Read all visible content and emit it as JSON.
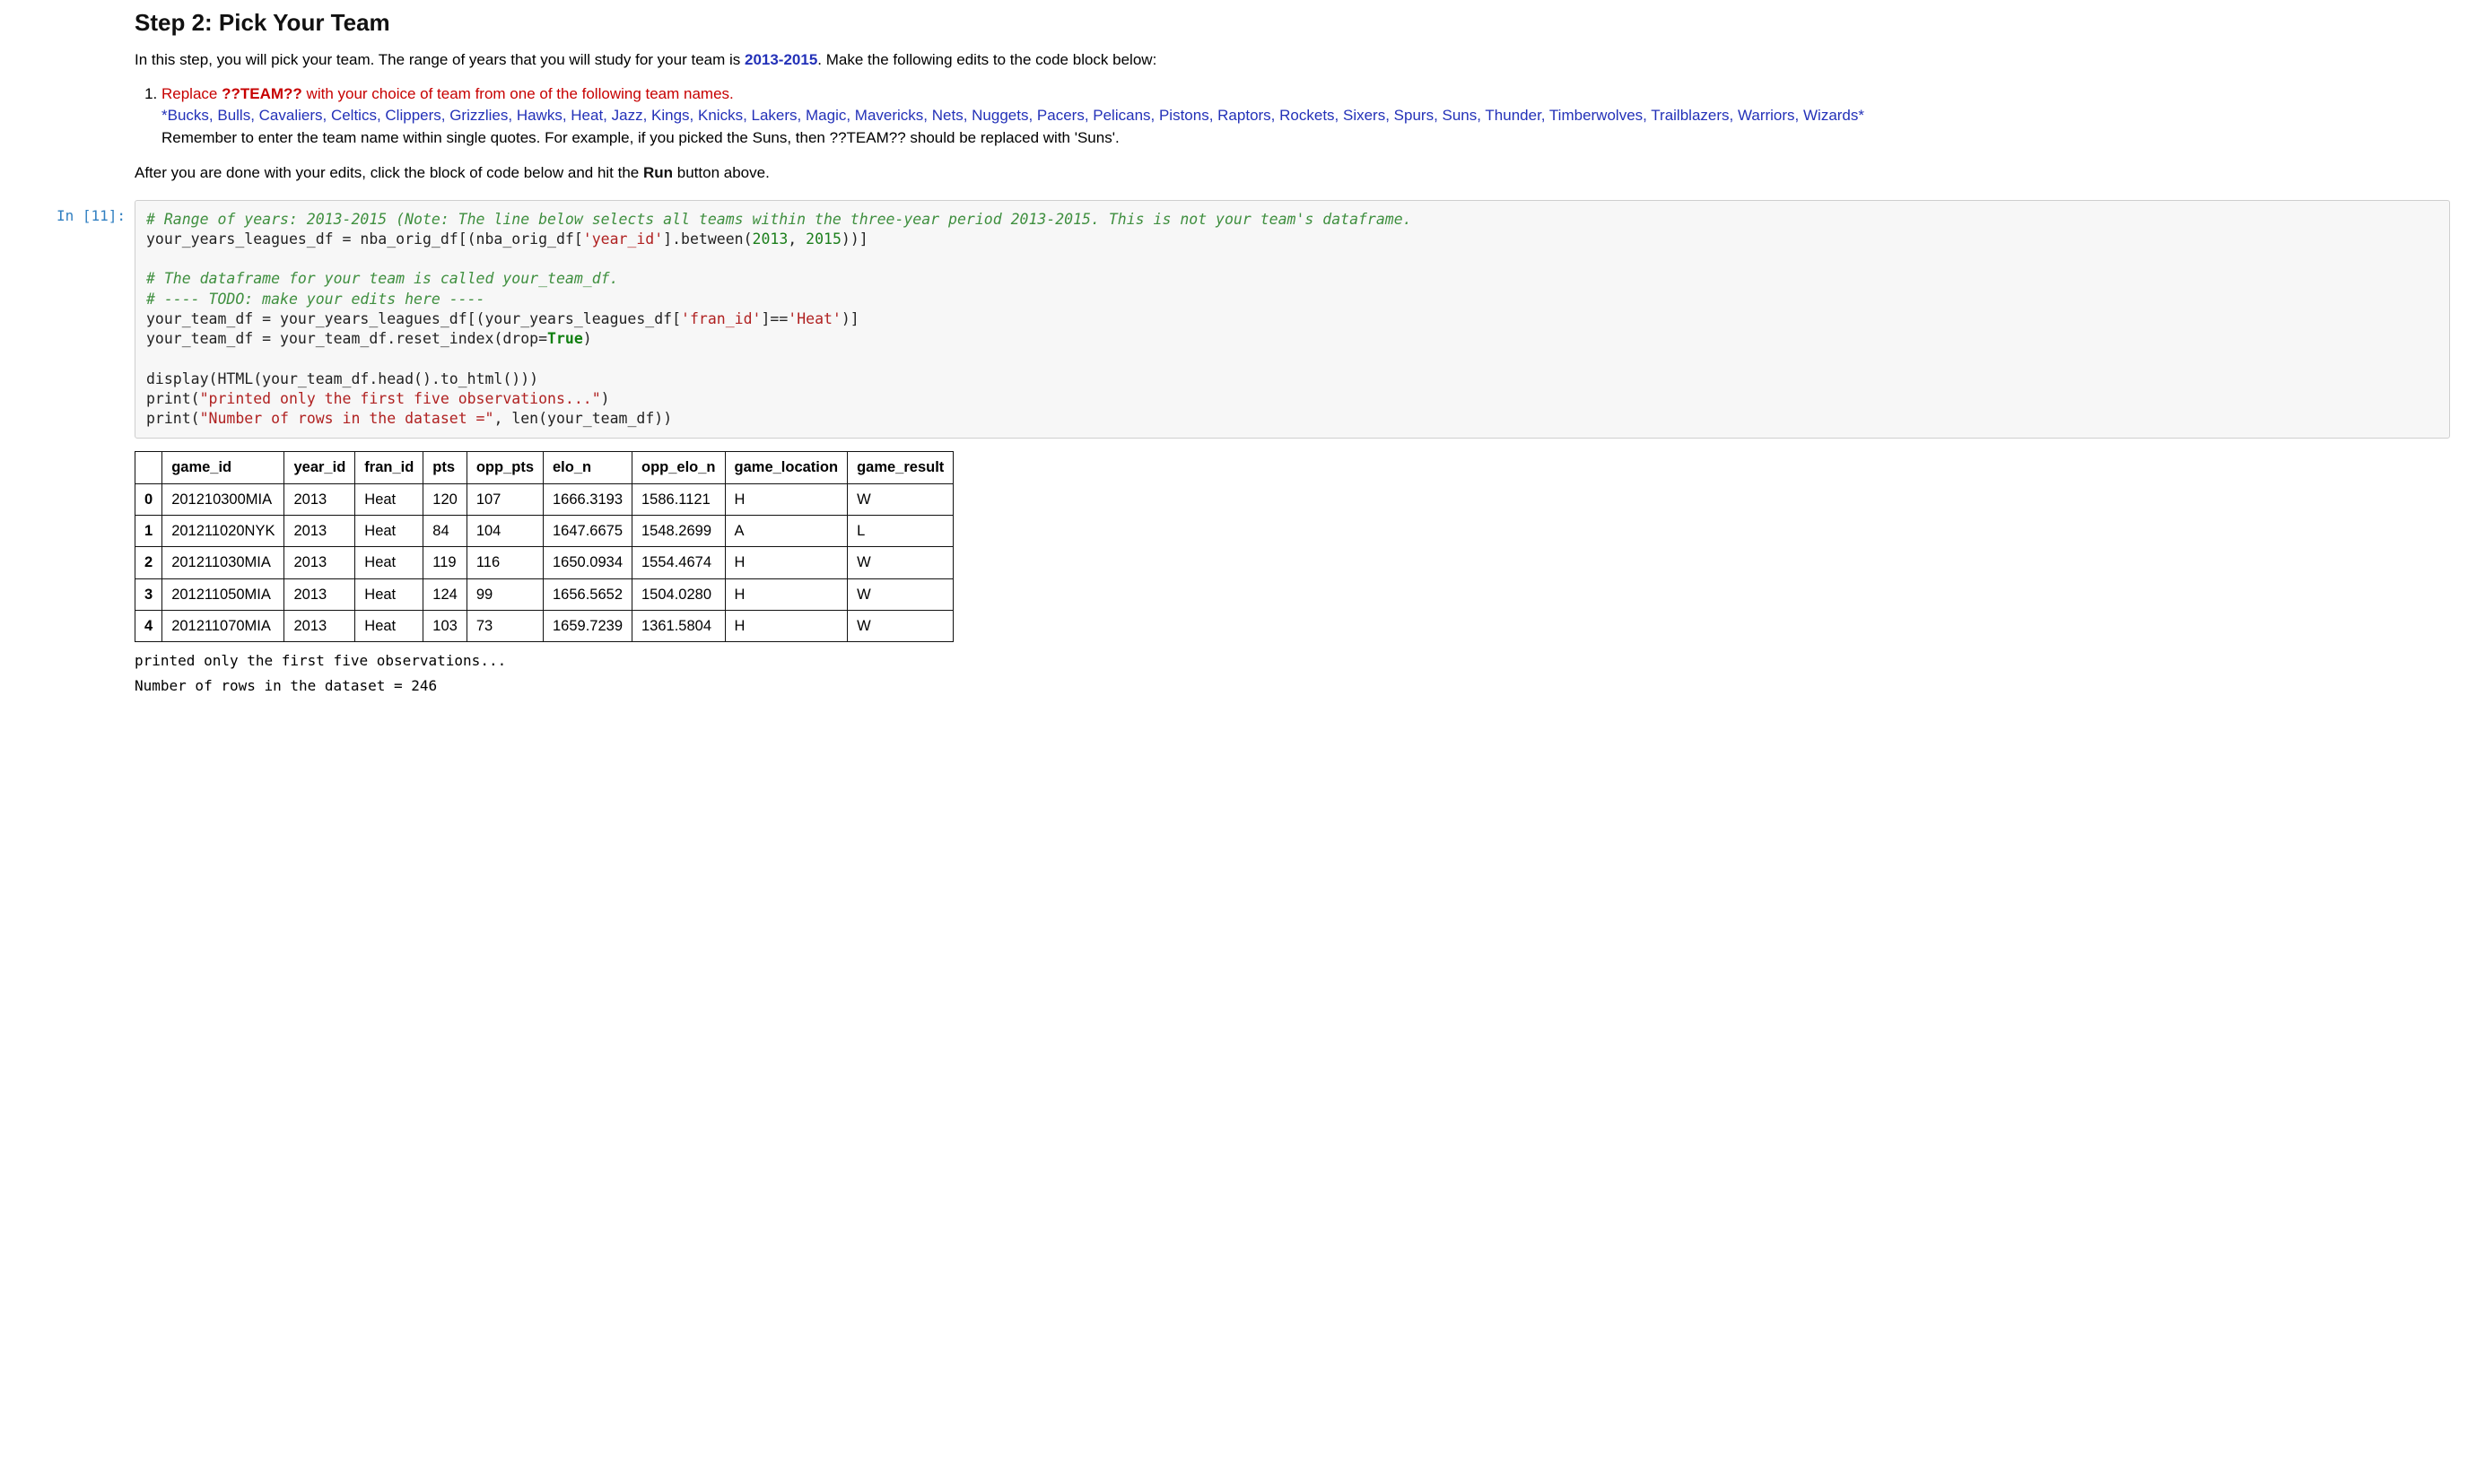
{
  "md": {
    "heading": "Step 2: Pick Your Team",
    "intro_a": "In this step, you will pick your team. The range of years that you will study for your team is ",
    "intro_years": "2013-2015",
    "intro_b": ". Make the following edits to the code block below:",
    "li_red_a": "Replace ",
    "li_red_token": "??TEAM??",
    "li_red_b": " with your choice of team from one of the following team names.",
    "li_teams": "*Bucks, Bulls, Cavaliers, Celtics, Clippers, Grizzlies, Hawks, Heat, Jazz, Kings, Knicks, Lakers, Magic, Mavericks, Nets, Nuggets, Pacers, Pelicans, Pistons, Raptors, Rockets, Sixers, Spurs, Suns, Thunder, Timberwolves, Trailblazers, Warriors, Wizards*",
    "li_remember": "Remember to enter the team name within single quotes. For example, if you picked the Suns, then ??TEAM?? should be replaced with 'Suns'.",
    "after_a": "After you are done with your edits, click the block of code below and hit the ",
    "after_run": "Run",
    "after_b": " button above."
  },
  "prompt_label": "In [11]:",
  "code": {
    "c1a": "# Range of years: 2013-2015 (Note: The line below selects all teams within the three-year period 2013-2015. This is not your team's dataframe.",
    "l2a": "your_years_leagues_df ",
    "l2b": "=",
    "l2c": " nba_orig_df[(nba_orig_df[",
    "l2d": "'year_id'",
    "l2e": "].between(",
    "l2f": "2013",
    "l2g": ", ",
    "l2h": "2015",
    "l2i": "))]",
    "c3": "# The dataframe for your team is called your_team_df.",
    "c4": "# ---- TODO: make your edits here ----",
    "l5a": "your_team_df ",
    "l5b": "=",
    "l5c": " your_years_leagues_df[(your_years_leagues_df[",
    "l5d": "'fran_id'",
    "l5e": "]",
    "l5f": "==",
    "l5g": "'Heat'",
    "l5h": ")]",
    "l6a": "your_team_df ",
    "l6b": "=",
    "l6c": " your_team_df.reset_index(drop",
    "l6d": "=",
    "l6e": "True",
    "l6f": ")",
    "l7": "display(HTML(your_team_df.head().to_html()))",
    "l8a": "print",
    "l8b": "(",
    "l8c": "\"printed only the first five observations...\"",
    "l8d": ")",
    "l9a": "print",
    "l9b": "(",
    "l9c": "\"Number of rows in the dataset =\"",
    "l9d": ", ",
    "l9e": "len",
    "l9f": "(your_team_df))"
  },
  "table": {
    "headers": [
      "",
      "game_id",
      "year_id",
      "fran_id",
      "pts",
      "opp_pts",
      "elo_n",
      "opp_elo_n",
      "game_location",
      "game_result"
    ],
    "rows": [
      [
        "0",
        "201210300MIA",
        "2013",
        "Heat",
        "120",
        "107",
        "1666.3193",
        "1586.1121",
        "H",
        "W"
      ],
      [
        "1",
        "201211020NYK",
        "2013",
        "Heat",
        "84",
        "104",
        "1647.6675",
        "1548.2699",
        "A",
        "L"
      ],
      [
        "2",
        "201211030MIA",
        "2013",
        "Heat",
        "119",
        "116",
        "1650.0934",
        "1554.4674",
        "H",
        "W"
      ],
      [
        "3",
        "201211050MIA",
        "2013",
        "Heat",
        "124",
        "99",
        "1656.5652",
        "1504.0280",
        "H",
        "W"
      ],
      [
        "4",
        "201211070MIA",
        "2013",
        "Heat",
        "103",
        "73",
        "1659.7239",
        "1361.5804",
        "H",
        "W"
      ]
    ]
  },
  "out_text_1": "printed only the first five observations...",
  "out_text_2": "Number of rows in the dataset = 246"
}
